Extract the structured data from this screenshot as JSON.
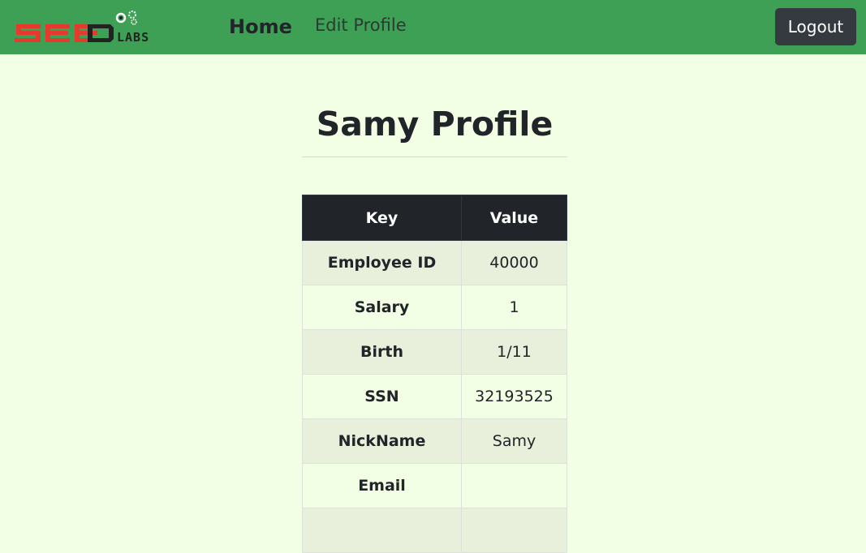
{
  "navbar": {
    "logo_alt": "SEED LABS",
    "home_label": "Home",
    "edit_profile_label": "Edit Profile",
    "logout_label": "Logout"
  },
  "page": {
    "title": "Samy Profile"
  },
  "table": {
    "headers": [
      "Key",
      "Value"
    ],
    "rows": [
      {
        "key": "Employee ID",
        "value": "40000"
      },
      {
        "key": "Salary",
        "value": "1"
      },
      {
        "key": "Birth",
        "value": "1/11"
      },
      {
        "key": "SSN",
        "value": "32193525"
      },
      {
        "key": "NickName",
        "value": "Samy"
      },
      {
        "key": "Email",
        "value": ""
      },
      {
        "key": "",
        "value": ""
      }
    ]
  },
  "colors": {
    "navbar_bg": "#3ea055",
    "page_bg": "#f3ffe4",
    "header_bg": "#212529",
    "logo_red": "#e53b2c",
    "logout_bg": "#343a40"
  }
}
